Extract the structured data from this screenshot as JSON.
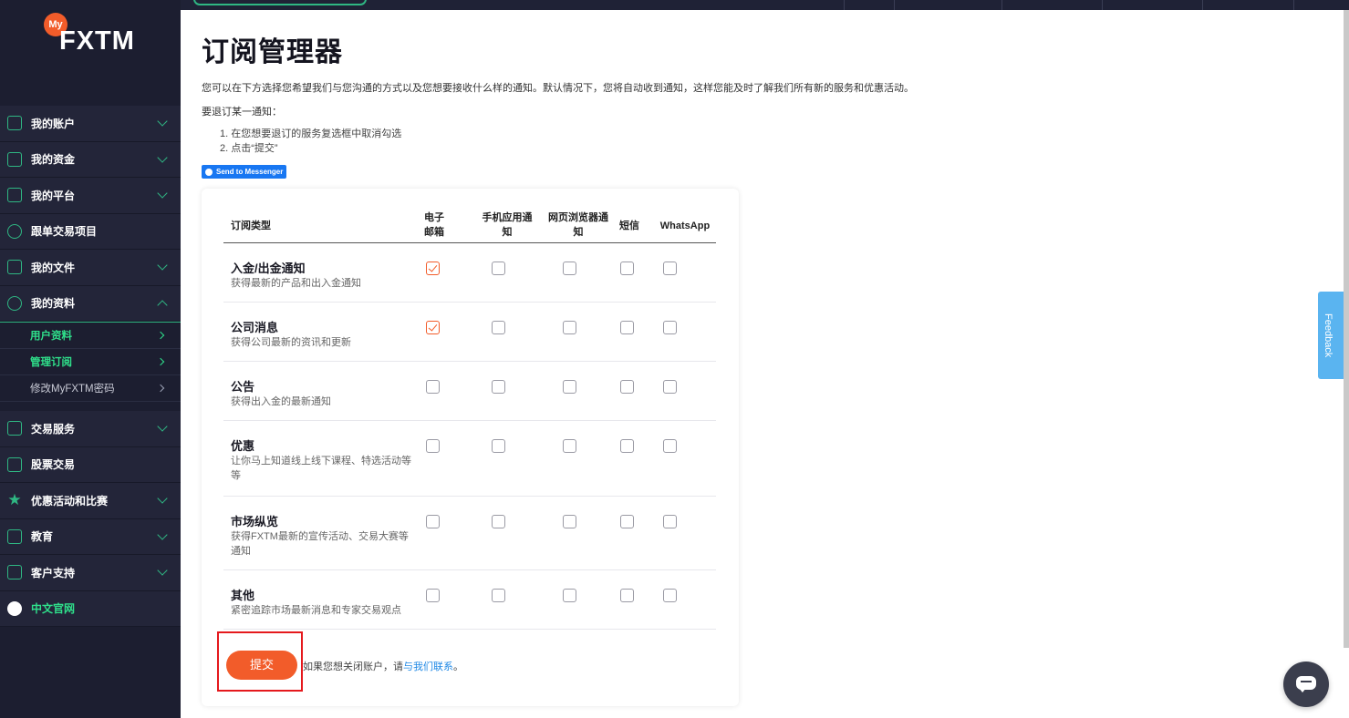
{
  "logo": {
    "my": "My",
    "name": "FXTM"
  },
  "sidebar": {
    "items": [
      {
        "label": "我的账户",
        "icon": "candlestick-icon"
      },
      {
        "label": "我的资金",
        "icon": "wallet-icon"
      },
      {
        "label": "我的平台",
        "icon": "monitor-icon"
      },
      {
        "label": "跟单交易项目",
        "icon": "users-icon"
      },
      {
        "label": "我的文件",
        "icon": "id-card-icon"
      },
      {
        "label": "我的资料",
        "icon": "user-circle-icon"
      }
    ],
    "sub_items": [
      {
        "label": "用户资料",
        "active": true
      },
      {
        "label": "管理订阅",
        "active": true
      },
      {
        "label": "修改MyFXTM密码",
        "active": false
      }
    ],
    "items_after": [
      {
        "label": "交易服务",
        "icon": "chart-line-icon"
      },
      {
        "label": "股票交易",
        "icon": "monitor-icon"
      },
      {
        "label": "优惠活动和比赛",
        "icon": "star-icon"
      },
      {
        "label": "教育",
        "icon": "presentation-icon"
      },
      {
        "label": "客户支持",
        "icon": "chat-icon"
      },
      {
        "label": "中文官网",
        "icon": "globe-icon"
      }
    ]
  },
  "page": {
    "title": "订阅管理器",
    "intro": "您可以在下方选择您希望我们与您沟通的方式以及您想要接收什么样的通知。默认情况下，您将自动收到通知，这样您能及时了解我们所有新的服务和优惠活动。",
    "howto": "要退订某一通知：",
    "steps": [
      "1. 在您想要退订的服务复选框中取消勾选",
      "2. 点击“提交”"
    ],
    "messenger_button": "Send to Messenger"
  },
  "table": {
    "headers": {
      "type": "订阅类型",
      "email": "电子邮箱",
      "app": "手机应用通知",
      "web": "网页浏览器通知",
      "sms": "短信",
      "whatsapp": "WhatsApp"
    },
    "rows": [
      {
        "title": "入金/出金通知",
        "desc": "获得最新的产品和出入金通知",
        "checks": [
          true,
          false,
          false,
          false,
          false
        ]
      },
      {
        "title": "公司消息",
        "desc": "获得公司最新的资讯和更新",
        "checks": [
          true,
          false,
          false,
          false,
          false
        ]
      },
      {
        "title": "公告",
        "desc": "获得出入金的最新通知",
        "checks": [
          false,
          false,
          false,
          false,
          false
        ]
      },
      {
        "title": "优惠",
        "desc": "让你马上知道线上线下课程、特选活动等等",
        "checks": [
          false,
          false,
          false,
          false,
          false
        ]
      },
      {
        "title": "市场纵览",
        "desc": "获得FXTM最新的宣传活动、交易大赛等通知",
        "checks": [
          false,
          false,
          false,
          false,
          false
        ]
      },
      {
        "title": "其他",
        "desc": "紧密追踪市场最新消息和专家交易观点",
        "checks": [
          false,
          false,
          false,
          false,
          false
        ]
      }
    ]
  },
  "actions": {
    "submit": "提交",
    "close_prefix": "如果您想关闭账户，请",
    "close_link": "与我们联系",
    "close_suffix": "。"
  },
  "feedback": "Feedback",
  "colors": {
    "accent": "#f25c2a",
    "sidebar": "#1c1e30",
    "green": "#2fb783",
    "link": "#1e88e5"
  }
}
